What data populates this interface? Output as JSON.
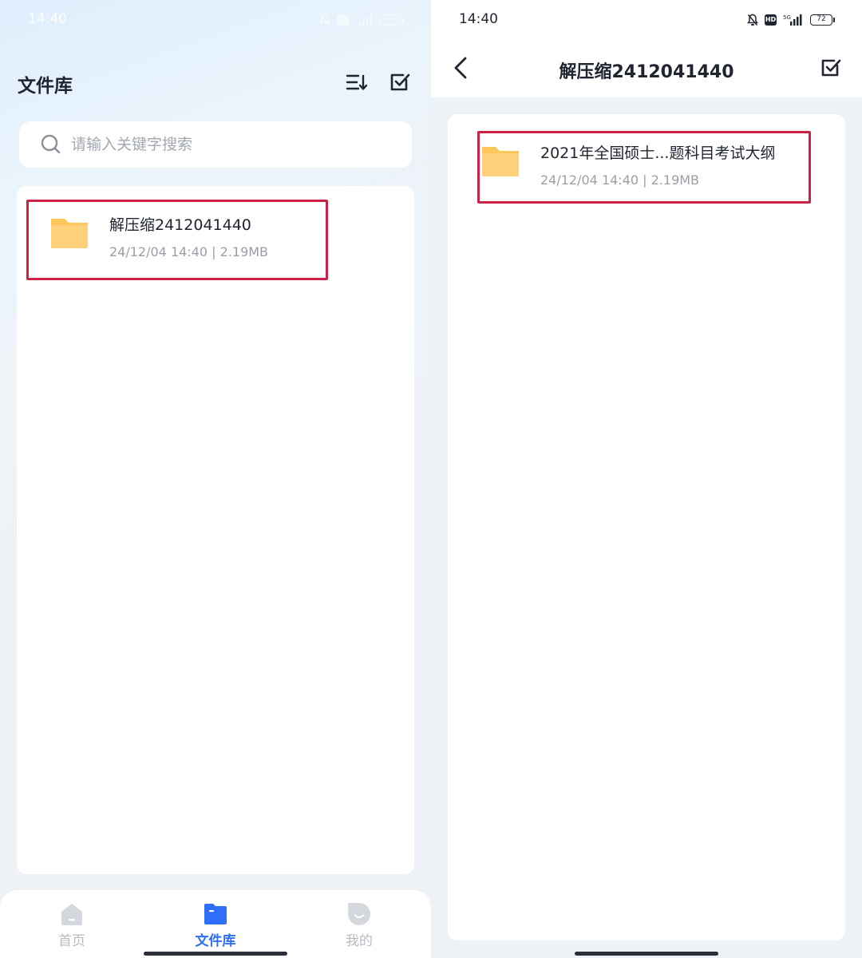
{
  "left": {
    "status": {
      "time": "14:40"
    },
    "title": "文件库",
    "search": {
      "placeholder": "请输入关键字搜索"
    },
    "files": [
      {
        "name": "解压缩2412041440",
        "meta": "24/12/04 14:40 | 2.19MB"
      }
    ],
    "nav": [
      {
        "label": "首页",
        "icon": "home-icon",
        "active": false
      },
      {
        "label": "文件库",
        "icon": "folder-icon",
        "active": true
      },
      {
        "label": "我的",
        "icon": "profile-icon",
        "active": false
      }
    ]
  },
  "right": {
    "status": {
      "time": "14:40",
      "battery": "72",
      "hd": "HD"
    },
    "title": "解压缩2412041440",
    "files": [
      {
        "name": "2021年全国硕士...题科目考试大纲",
        "meta": "24/12/04 14:40 | 2.19MB"
      }
    ]
  },
  "colors": {
    "accent": "#2f6ef6",
    "highlight": "#cc2246",
    "folder": "#ffc65c"
  }
}
